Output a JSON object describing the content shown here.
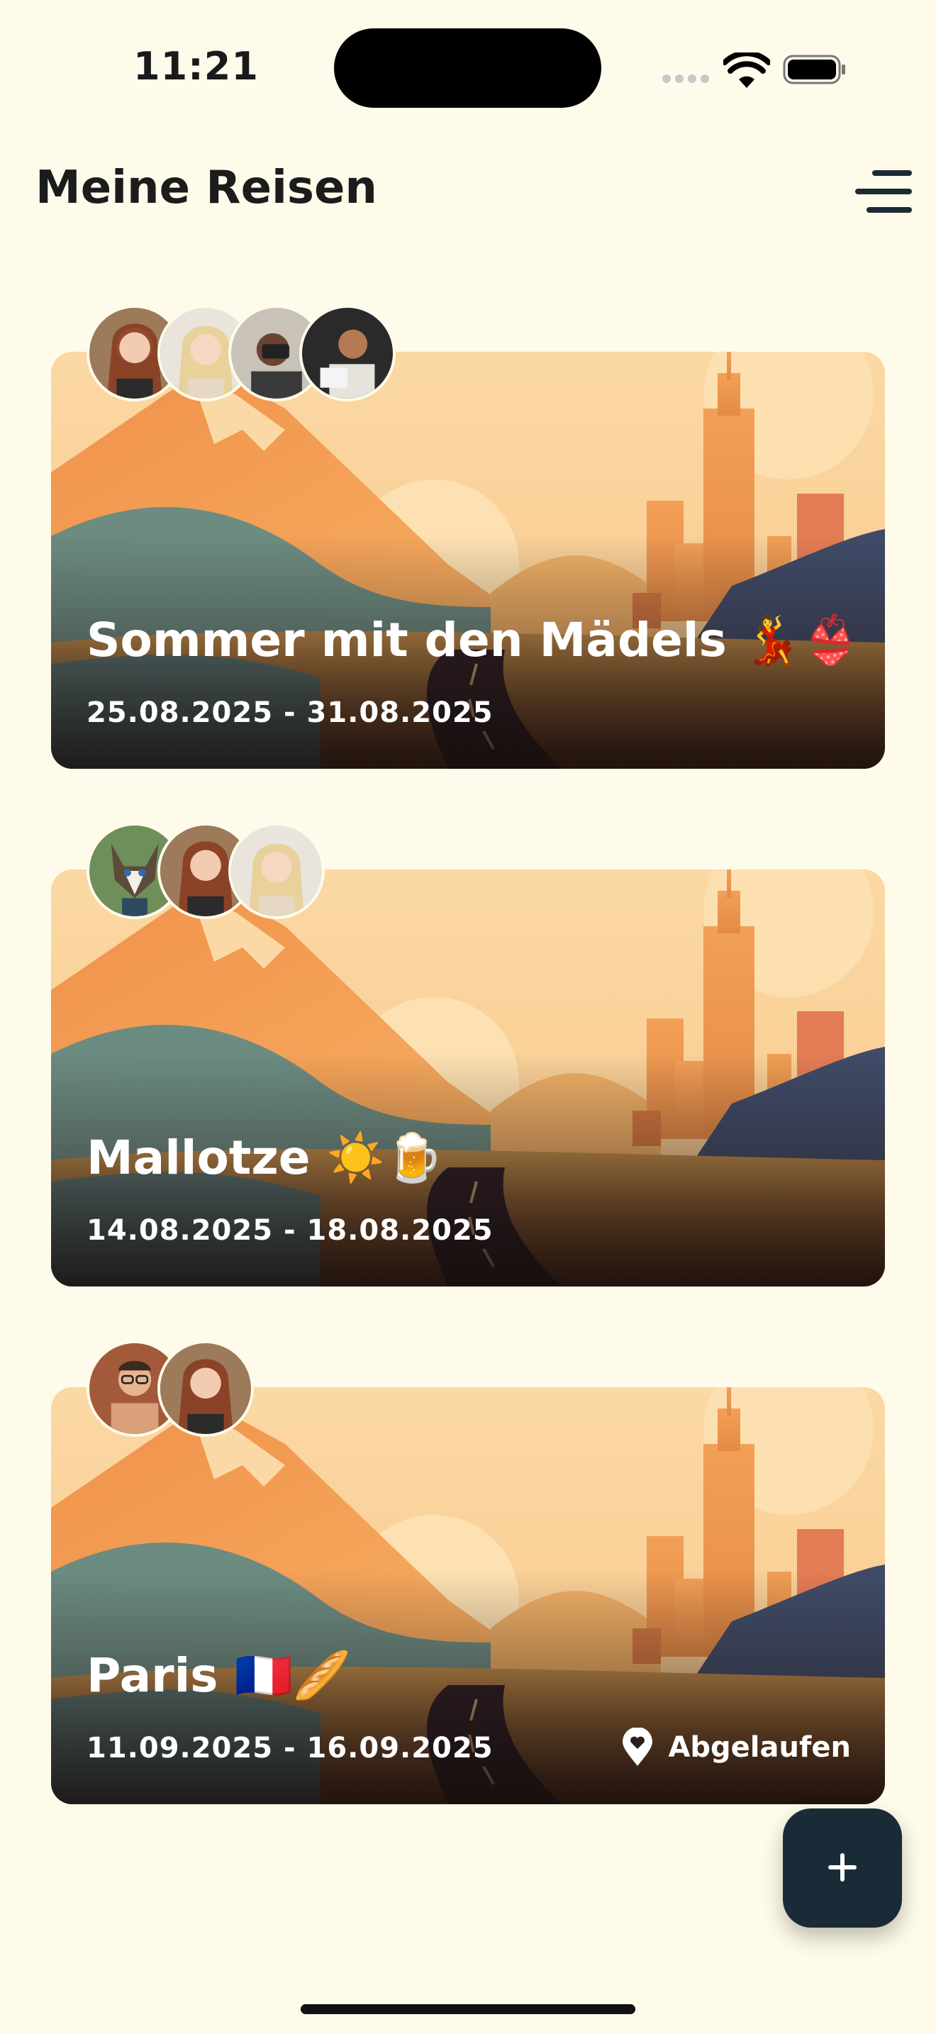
{
  "status_bar": {
    "time": "11:21"
  },
  "header": {
    "title": "Meine Reisen"
  },
  "trips": [
    {
      "title": "Sommer mit den Mädels 💃👙",
      "dates": "25.08.2025 - 31.08.2025",
      "status": "",
      "avatars": [
        "woman-auburn",
        "woman-blonde",
        "woman-camera",
        "woman-reading"
      ]
    },
    {
      "title": "Mallotze ☀️🍺",
      "dates": "14.08.2025 - 18.08.2025",
      "status": "",
      "avatars": [
        "dog-husky",
        "woman-auburn",
        "woman-blonde"
      ]
    },
    {
      "title": "Paris 🇫🇷🥖",
      "dates": "11.09.2025 - 16.09.2025",
      "status": "Abgelaufen",
      "avatars": [
        "man-glasses",
        "woman-auburn"
      ]
    }
  ],
  "fab": {
    "icon": "plus-icon"
  },
  "colors": {
    "background": "#fefbea",
    "fab": "#1a2b38",
    "text": "#1c1c1c"
  }
}
